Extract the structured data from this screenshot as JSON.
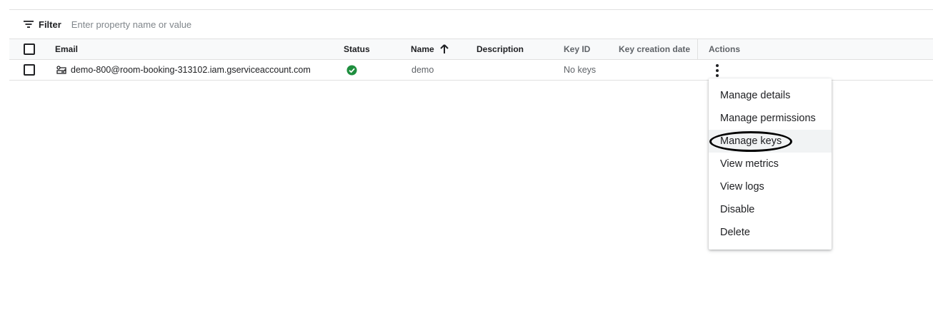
{
  "filter": {
    "label": "Filter",
    "placeholder": "Enter property name or value"
  },
  "table": {
    "headers": {
      "email": "Email",
      "status": "Status",
      "name": "Name",
      "description": "Description",
      "key_id": "Key ID",
      "key_creation_date": "Key creation date",
      "actions": "Actions"
    },
    "sort": {
      "column": "Name",
      "direction": "ascending",
      "icon": "arrow-up-icon"
    },
    "rows": [
      {
        "email": "demo-800@room-booking-313102.iam.gserviceaccount.com",
        "status_icon": "check-circle-icon",
        "status_color": "#1e8e3e",
        "name": "demo",
        "description": "",
        "key_id": "No keys",
        "key_creation_date": ""
      }
    ]
  },
  "actions_menu": {
    "items": [
      {
        "label": "Manage details"
      },
      {
        "label": "Manage permissions"
      },
      {
        "label": "Manage keys",
        "highlighted": true
      },
      {
        "label": "View metrics"
      },
      {
        "label": "View logs"
      },
      {
        "label": "Disable"
      },
      {
        "label": "Delete"
      }
    ]
  }
}
